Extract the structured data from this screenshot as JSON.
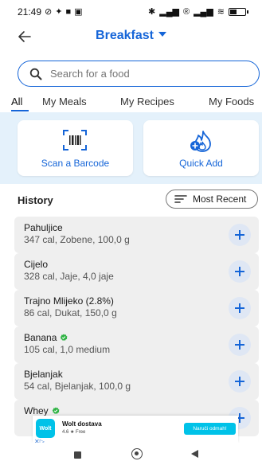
{
  "status_bar": {
    "time": "21:49",
    "left_icons": [
      "blocked-icon",
      "messenger-icon",
      "lock-icon",
      "message-icon"
    ],
    "right_icons": [
      "bluetooth-icon",
      "signal-icon",
      "volte-icon",
      "signal-icon",
      "wifi-icon",
      "battery-icon"
    ],
    "battery_level": 0.45
  },
  "header": {
    "title": "Breakfast"
  },
  "search": {
    "placeholder": "Search for a food"
  },
  "tabs": [
    {
      "label": "All"
    },
    {
      "label": "My Meals"
    },
    {
      "label": "My Recipes"
    },
    {
      "label": "My Foods"
    }
  ],
  "quick_actions": {
    "scan_label": "Scan a Barcode",
    "quick_add_label": "Quick Add"
  },
  "history": {
    "title": "History",
    "sort_label": "Most Recent",
    "items": [
      {
        "name": "Pahuljice",
        "detail": "347 cal, Zobene, 100,0 g",
        "verified": false
      },
      {
        "name": "Cijelo",
        "detail": "328 cal, Jaje, 4,0 jaje",
        "verified": false
      },
      {
        "name": "Trajno Mlijeko (2.8%)",
        "detail": "86 cal, Dukat, 150,0 g",
        "verified": false
      },
      {
        "name": "Banana",
        "detail": "105 cal, 1,0 medium",
        "verified": true
      },
      {
        "name": "Bjelanjak",
        "detail": "54 cal, Bjelanjak, 100,0 g",
        "verified": false
      },
      {
        "name": "Whey",
        "detail": "",
        "verified": true
      }
    ]
  },
  "ad": {
    "logo_text": "Wolt",
    "name": "Wolt dostava",
    "rating": "4.6 ★  Free",
    "cta": "Naruči odmah!"
  },
  "colors": {
    "accent": "#1565d8",
    "panel_bg": "#e4f1fb",
    "row_bg": "#efefef",
    "verified": "#2fb344"
  }
}
